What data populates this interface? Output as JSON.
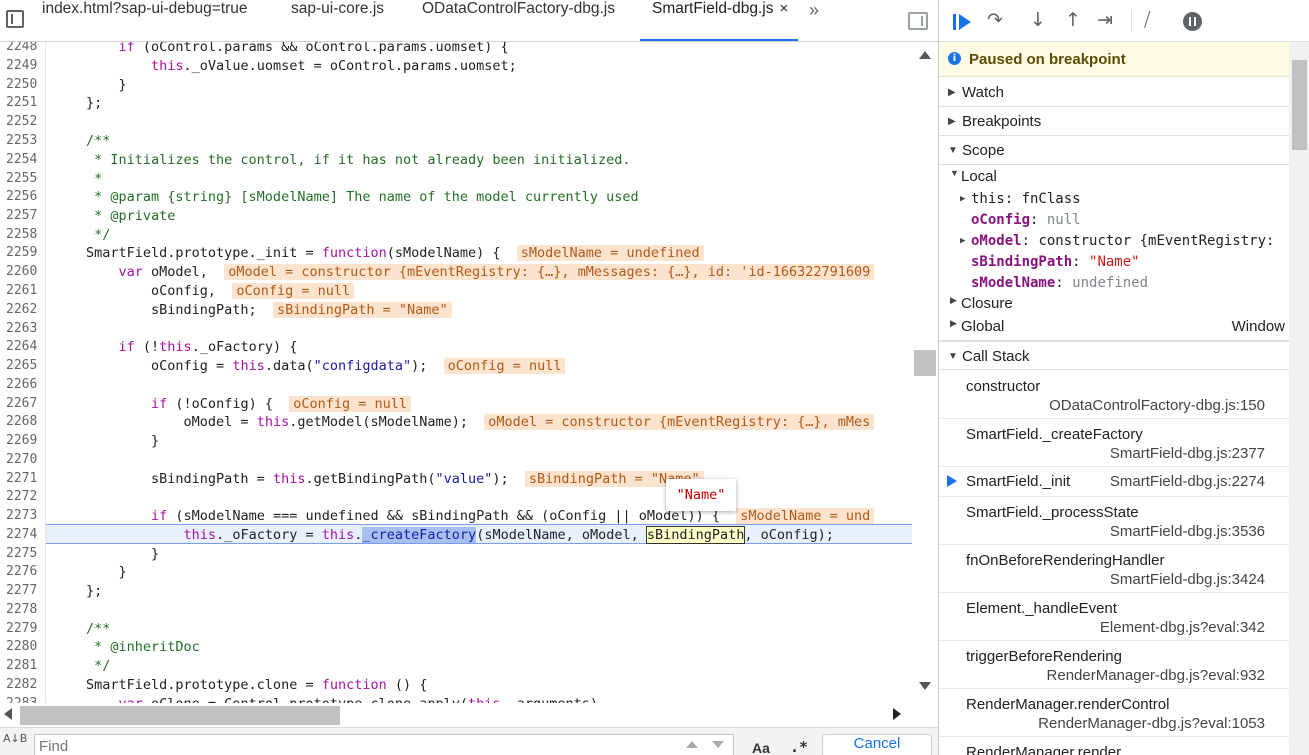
{
  "tabs": [
    {
      "label": "index.html?sap-ui-debug=true"
    },
    {
      "label": "sap-ui-core.js"
    },
    {
      "label": "ODataControlFactory-dbg.js"
    },
    {
      "label": "SmartField-dbg.js",
      "close": "×"
    }
  ],
  "tab_more": "»",
  "icons": [
    "sidebar-toggle-icon",
    "more-tabs-icon",
    "toggle-debugger-sidebar-icon",
    "resume-icon",
    "step-over-icon",
    "step-into-icon",
    "step-out-icon",
    "step-icon",
    "deactivate-breakpoints-icon",
    "pause-on-exceptions-icon",
    "info-icon",
    "scroll-up-icon",
    "scroll-down-icon",
    "scroll-left-icon",
    "scroll-right-icon",
    "regex-icon",
    "case-icon",
    "up-icon",
    "down-icon"
  ],
  "code": {
    "lines": [
      {
        "n": "2248"
      },
      {
        "n": "2249"
      },
      {
        "n": "2250"
      },
      {
        "n": "2251"
      },
      {
        "n": "2252"
      },
      {
        "n": "2253"
      },
      {
        "n": "2254"
      },
      {
        "n": "2255"
      },
      {
        "n": "2256"
      },
      {
        "n": "2257"
      },
      {
        "n": "2258"
      },
      {
        "n": "2259"
      },
      {
        "n": "2260"
      },
      {
        "n": "2261"
      },
      {
        "n": "2262"
      },
      {
        "n": "2263"
      },
      {
        "n": "2264"
      },
      {
        "n": "2265"
      },
      {
        "n": "2266"
      },
      {
        "n": "2267"
      },
      {
        "n": "2268"
      },
      {
        "n": "2269"
      },
      {
        "n": "2270"
      },
      {
        "n": "2271"
      },
      {
        "n": "2272"
      },
      {
        "n": "2273"
      },
      {
        "n": "2274"
      },
      {
        "n": "2275"
      },
      {
        "n": "2276"
      },
      {
        "n": "2277"
      },
      {
        "n": "2278"
      },
      {
        "n": "2279"
      },
      {
        "n": "2280"
      },
      {
        "n": "2281"
      },
      {
        "n": "2282"
      },
      {
        "n": "2283"
      }
    ],
    "tooltip": "\"Name\""
  },
  "find": {
    "placeholder": "Find",
    "case": "Aa",
    "regex": ".*",
    "cancel": "Cancel",
    "icon_label": "A↓B"
  },
  "debugger": {
    "paused": "Paused on breakpoint",
    "sections": {
      "watch": "Watch",
      "breakpoints": "Breakpoints",
      "scope": "Scope",
      "callstack": "Call Stack"
    },
    "scope": {
      "local_label": "Local",
      "rows": [
        {
          "key": "this",
          "value": "fnClass"
        },
        {
          "key": "oConfig",
          "value": "null"
        },
        {
          "key": "oModel",
          "value": "constructor {mEventRegistry:"
        },
        {
          "key": "sBindingPath",
          "value": "\"Name\""
        },
        {
          "key": "sModelName",
          "value": "undefined"
        }
      ],
      "closure_label": "Closure",
      "global_label": "Global",
      "global_value": "Window"
    },
    "frames": [
      {
        "fn": "constructor",
        "loc": "ODataControlFactory-dbg.js:150"
      },
      {
        "fn": "SmartField._createFactory",
        "loc": "SmartField-dbg.js:2377"
      },
      {
        "fn": "SmartField._init",
        "loc": "SmartField-dbg.js:2274"
      },
      {
        "fn": "SmartField._processState",
        "loc": "SmartField-dbg.js:3536"
      },
      {
        "fn": "fnOnBeforeRenderingHandler",
        "loc": "SmartField-dbg.js:3424"
      },
      {
        "fn": "Element._handleEvent",
        "loc": "Element-dbg.js?eval:342"
      },
      {
        "fn": "triggerBeforeRendering",
        "loc": "RenderManager-dbg.js?eval:932"
      },
      {
        "fn": "RenderManager.renderControl",
        "loc": "RenderManager-dbg.js?eval:1053"
      },
      {
        "fn": "RenderManager.render",
        "loc": ""
      }
    ]
  },
  "colors": {
    "accent": "#1a73e8",
    "paused_bg": "#fffbe5",
    "inline_value_bg": "#fbe3cd",
    "keyword": "#a811a3",
    "comment": "#236e25"
  }
}
